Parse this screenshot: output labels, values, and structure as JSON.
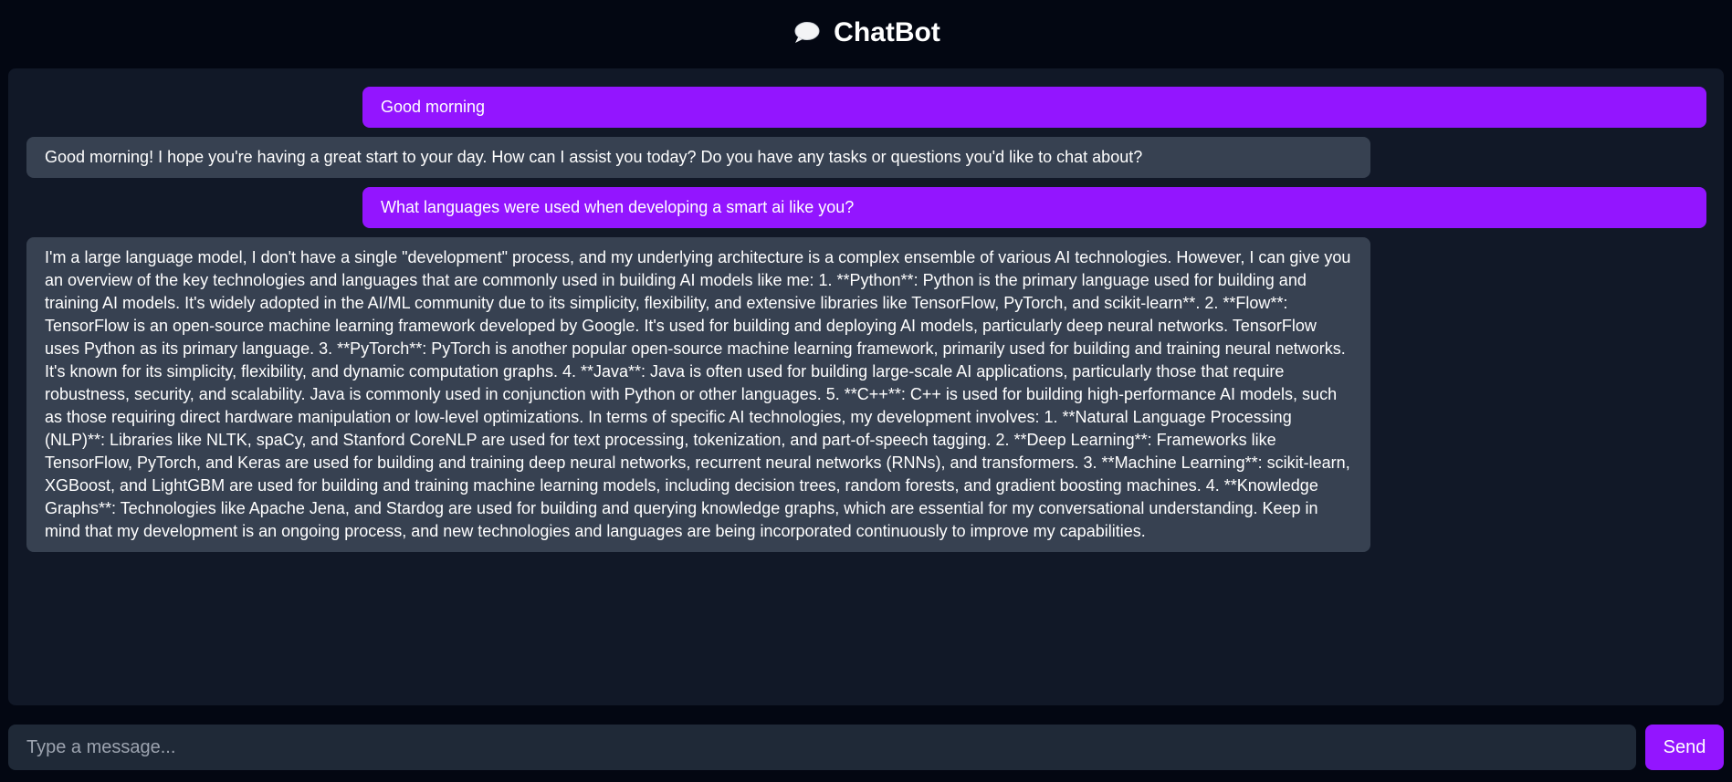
{
  "header": {
    "title": "ChatBot",
    "icon": "speech-bubble-icon"
  },
  "messages": [
    {
      "role": "user",
      "text": "Good morning"
    },
    {
      "role": "bot",
      "text": "Good morning! I hope you're having a great start to your day. How can I assist you today? Do you have any tasks or questions you'd like to chat about?"
    },
    {
      "role": "user",
      "text": "What languages were used when developing a smart ai like you?"
    },
    {
      "role": "bot",
      "text": "I'm a large language model, I don't have a single \"development\" process, and my underlying architecture is a complex ensemble of various AI technologies. However, I can give you an overview of the key technologies and languages that are commonly used in building AI models like me: 1. **Python**: Python is the primary language used for building and training AI models. It's widely adopted in the AI/ML community due to its simplicity, flexibility, and extensive libraries like TensorFlow, PyTorch, and scikit-learn**. 2. **Flow**: TensorFlow is an open-source machine learning framework developed by Google. It's used for building and deploying AI models, particularly deep neural networks. TensorFlow uses Python as its primary language. 3. **PyTorch**: PyTorch is another popular open-source machine learning framework, primarily used for building and training neural networks. It's known for its simplicity, flexibility, and dynamic computation graphs. 4. **Java**: Java is often used for building large-scale AI applications, particularly those that require robustness, security, and scalability. Java is commonly used in conjunction with Python or other languages. 5. **C++**: C++ is used for building high-performance AI models, such as those requiring direct hardware manipulation or low-level optimizations. In terms of specific AI technologies, my development involves: 1. **Natural Language Processing (NLP)**: Libraries like NLTK, spaCy, and Stanford CoreNLP are used for text processing, tokenization, and part-of-speech tagging. 2. **Deep Learning**: Frameworks like TensorFlow, PyTorch, and Keras are used for building and training deep neural networks, recurrent neural networks (RNNs), and transformers. 3. **Machine Learning**: scikit-learn, XGBoost, and LightGBM are used for building and training machine learning models, including decision trees, random forests, and gradient boosting machines. 4. **Knowledge Graphs**: Technologies like Apache Jena, and Stardog are used for building and querying knowledge graphs, which are essential for my conversational understanding. Keep in mind that my development is an ongoing process, and new technologies and languages are being incorporated continuously to improve my capabilities."
    }
  ],
  "composer": {
    "placeholder": "Type a message...",
    "value": "",
    "send_label": "Send"
  },
  "colors": {
    "background": "#030712",
    "chat_panel": "#111827",
    "user_bubble": "#9315ff",
    "bot_bubble": "#374151",
    "input_bg": "#1f2937",
    "send_button": "#9315ff"
  }
}
